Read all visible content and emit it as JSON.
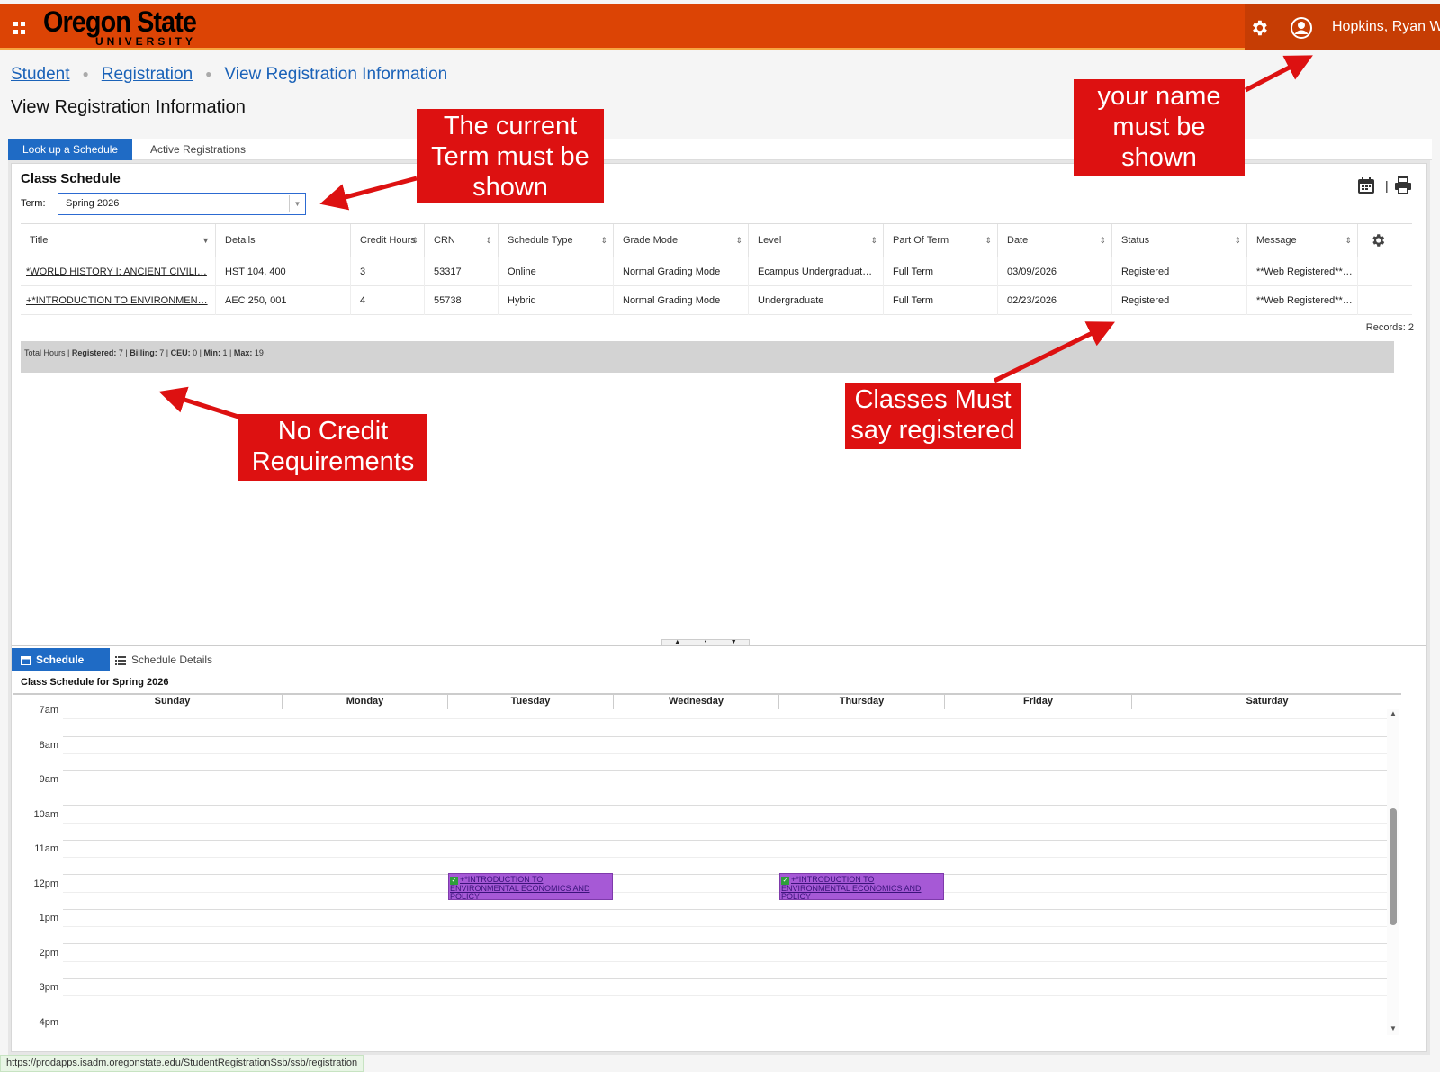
{
  "header": {
    "logo_main": "Oregon State",
    "logo_sub": "UNIVERSITY",
    "user_name": "Hopkins, Ryan W",
    "accent": "#dc4405"
  },
  "breadcrumb": {
    "items": [
      "Student",
      "Registration",
      "View Registration Information"
    ]
  },
  "page_title": "View Registration Information",
  "tabs": {
    "lookup": "Look up a Schedule",
    "active": "Active Registrations"
  },
  "class_schedule": {
    "title": "Class Schedule",
    "term_label": "Term:",
    "term_value": "Spring 2026",
    "columns": [
      "Title",
      "Details",
      "Credit Hours",
      "CRN",
      "Schedule Type",
      "Grade Mode",
      "Level",
      "Part Of Term",
      "Date",
      "Status",
      "Message"
    ],
    "rows": [
      [
        "*WORLD HISTORY I: ANCIENT CIVILI…",
        "HST 104, 400",
        "3",
        "53317",
        "Online",
        "Normal Grading Mode",
        "Ecampus Undergraduat…",
        "Full Term",
        "03/09/2026",
        "Registered",
        "**Web Registered**…"
      ],
      [
        "+*INTRODUCTION TO ENVIRONMEN…",
        "AEC 250, 001",
        "4",
        "55738",
        "Hybrid",
        "Normal Grading Mode",
        "Undergraduate",
        "Full Term",
        "02/23/2026",
        "Registered",
        "**Web Registered**…"
      ]
    ],
    "records": "Records: 2",
    "totals": {
      "label": "Total Hours",
      "registered_label": "Registered:",
      "registered": "7",
      "billing_label": "Billing:",
      "billing": "7",
      "ceu_label": "CEU:",
      "ceu": "0",
      "min_label": "Min:",
      "min": "1",
      "max_label": "Max:",
      "max": "19"
    }
  },
  "bottom_tabs": {
    "schedule": "Schedule",
    "details": "Schedule Details"
  },
  "calendar": {
    "title": "Class Schedule for Spring 2026",
    "days": [
      "Sunday",
      "Monday",
      "Tuesday",
      "Wednesday",
      "Thursday",
      "Friday",
      "Saturday"
    ],
    "hours": [
      "7am",
      "8am",
      "9am",
      "10am",
      "11am",
      "12pm",
      "1pm",
      "2pm",
      "3pm",
      "4pm"
    ],
    "event_text": "+*INTRODUCTION TO ENVIRONMENTAL ECONOMICS AND POLICY",
    "event_color": "#a659d6"
  },
  "status_url": "https://prodapps.isadm.oregonstate.edu/StudentRegistrationSsb/ssb/registration",
  "annotations": {
    "term": "The current Term must be shown",
    "name": "your name must be shown",
    "credits": "No Credit Requirements",
    "registered": "Classes Must say registered",
    "color": "#dd1111"
  }
}
